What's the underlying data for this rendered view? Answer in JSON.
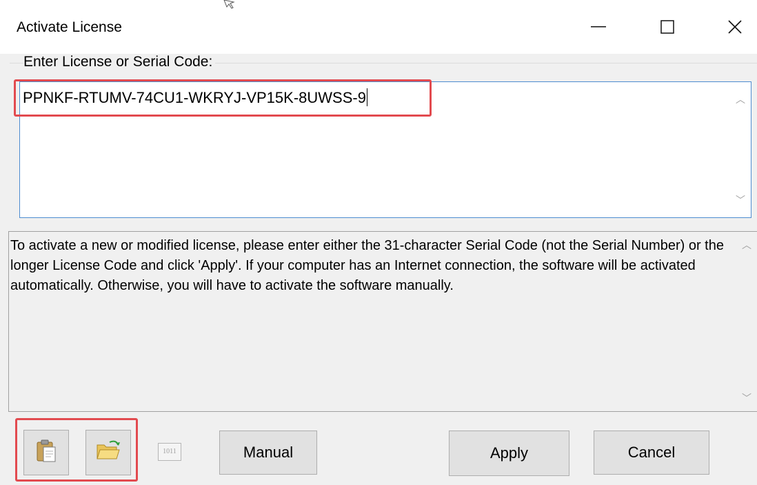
{
  "window": {
    "title": "Activate License",
    "controls": {
      "minimize": "—",
      "maximize": "□",
      "close": "✕"
    }
  },
  "license_group": {
    "label": "Enter License or Serial Code:",
    "value": "PPNKF-RTUMV-74CU1-WKRYJ-VP15K-8UWSS-9"
  },
  "info": {
    "text": "To activate a new or modified license, please enter either the 31-character Serial Code (not the Serial Number) or the longer License Code and click 'Apply'.  If your computer has an Internet connection, the software will be activated automatically.  Otherwise, you will have to activate the software manually."
  },
  "toolbar": {
    "paste_icon": "clipboard-paste-icon",
    "open_icon": "folder-open-icon",
    "binary_icon": "binary-1011-icon",
    "binary_label": "1011",
    "manual_label": "Manual",
    "apply_label": "Apply",
    "cancel_label": "Cancel"
  },
  "colors": {
    "highlight": "#e24a4f",
    "input_border": "#4d8cd0",
    "window_bg": "#f0f0f0"
  }
}
